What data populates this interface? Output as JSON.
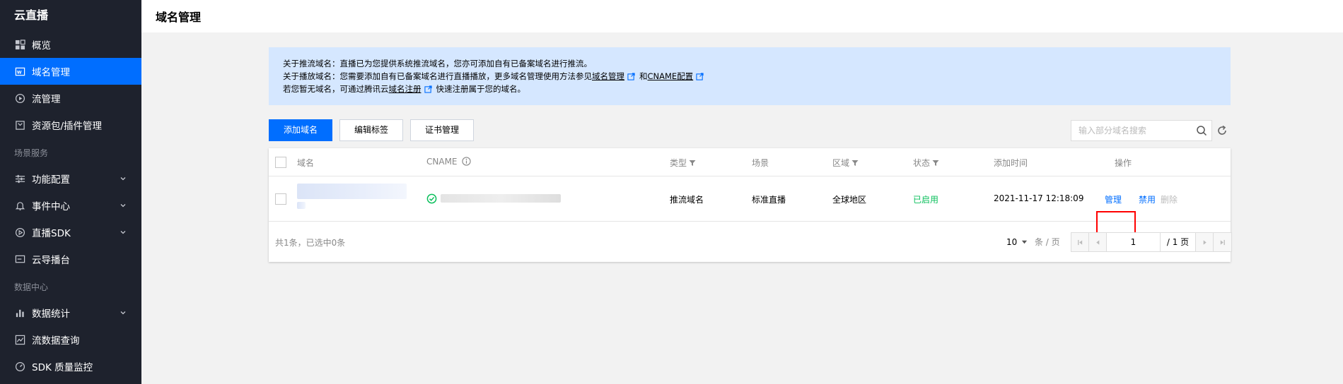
{
  "sidebar": {
    "logo": "云直播",
    "items_top": [
      {
        "label": "概览",
        "icon": "grid-icon"
      },
      {
        "label": "域名管理",
        "icon": "domain-icon",
        "active": true
      },
      {
        "label": "流管理",
        "icon": "play-circle-icon"
      },
      {
        "label": "资源包/插件管理",
        "icon": "box-icon"
      }
    ],
    "group1": "场景服务",
    "items_scene": [
      {
        "label": "功能配置",
        "icon": "sliders-icon"
      },
      {
        "label": "事件中心",
        "icon": "bell-icon"
      },
      {
        "label": "直播SDK",
        "icon": "play-icon"
      },
      {
        "label": "云导播台",
        "icon": "monitor-icon"
      }
    ],
    "group2": "数据中心",
    "items_data": [
      {
        "label": "数据统计",
        "icon": "bar-chart-icon"
      },
      {
        "label": "流数据查询",
        "icon": "line-chart-icon"
      },
      {
        "label": "SDK 质量监控",
        "icon": "gauge-icon"
      }
    ]
  },
  "header": {
    "title": "域名管理"
  },
  "notice": {
    "line1": "关于推流域名：直播已为您提供系统推流域名，您亦可添加自有已备案域名进行推流。",
    "line2_prefix": "关于播放域名：您需要添加自有已备案域名进行直播播放，更多域名管理使用方法参见",
    "line2_link1": "域名管理",
    "line2_mid": "和",
    "line2_link2": "CNAME配置",
    "line3_prefix": "若您暂无域名，可通过腾讯云",
    "line3_link": "域名注册",
    "line3_suffix": "快速注册属于您的域名。"
  },
  "toolbar": {
    "add_label": "添加域名",
    "edit_tags_label": "编辑标签",
    "cert_label": "证书管理",
    "search_placeholder": "输入部分域名搜索"
  },
  "table": {
    "headers": {
      "domain": "域名",
      "cname": "CNAME",
      "type": "类型",
      "scene": "场景",
      "region": "区域",
      "status": "状态",
      "added": "添加时间",
      "actions": "操作"
    },
    "rows": [
      {
        "type": "推流域名",
        "scene": "标准直播",
        "region": "全球地区",
        "status": "已启用",
        "added": "2021-11-17 12:18:09",
        "action_manage": "管理",
        "action_disable": "禁用",
        "action_delete": "删除"
      }
    ],
    "footer": {
      "summary": "共1条，已选中0条",
      "page_size": "10",
      "page_size_unit": "条 / 页",
      "current_page": "1",
      "total_pages": "/ 1 页"
    }
  },
  "colors": {
    "primary": "#006eff",
    "sidebar_bg": "#1e222d",
    "success": "#0abf5b",
    "highlight": "#ff0000"
  }
}
